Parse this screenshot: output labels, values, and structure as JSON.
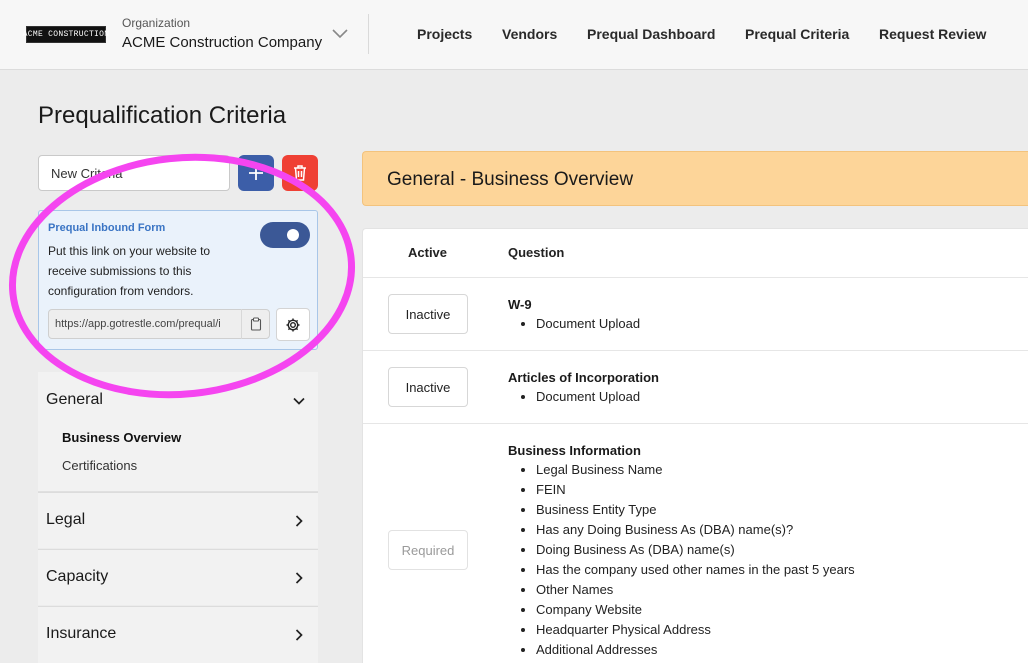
{
  "header": {
    "logo_text": "ACME CONSTRUCTION",
    "org_label": "Organization",
    "org_name": "ACME Construction Company",
    "nav": [
      "Projects",
      "Vendors",
      "Prequal Dashboard",
      "Prequal Criteria",
      "Request Review"
    ]
  },
  "left": {
    "page_title": "Prequalification Criteria",
    "criteria_input_value": "New Criteria",
    "inbound": {
      "title": "Prequal Inbound Form",
      "description": "Put this link on your website to receive submissions to this configuration from vendors.",
      "link": "https://app.gotrestle.com/prequal/i",
      "enabled": true
    },
    "sections": [
      {
        "label": "General",
        "expanded": true,
        "items": [
          "Business Overview",
          "Certifications"
        ]
      },
      {
        "label": "Legal",
        "expanded": false
      },
      {
        "label": "Capacity",
        "expanded": false
      },
      {
        "label": "Insurance",
        "expanded": false
      }
    ]
  },
  "right": {
    "group_title": "General - Business Overview",
    "columns": [
      "Active",
      "Question"
    ],
    "rows": [
      {
        "status": "Inactive",
        "title": "W-9",
        "items": [
          "Document Upload"
        ]
      },
      {
        "status": "Inactive",
        "title": "Articles of Incorporation",
        "items": [
          "Document Upload"
        ]
      },
      {
        "status": "Required",
        "title": "Business Information",
        "items": [
          "Legal Business Name",
          "FEIN",
          "Business Entity Type",
          "Has any Doing Business As (DBA) name(s)?",
          "Doing Business As (DBA) name(s)",
          "Has the company used other names in the past 5 years",
          "Other Names",
          "Company Website",
          "Headquarter Physical Address",
          "Additional Addresses"
        ]
      }
    ]
  },
  "colors": {
    "accent_blue": "#3c5ea8",
    "danger_red": "#ef4034",
    "banner_orange": "#fdd599",
    "highlight_magenta": "#f545f0"
  }
}
